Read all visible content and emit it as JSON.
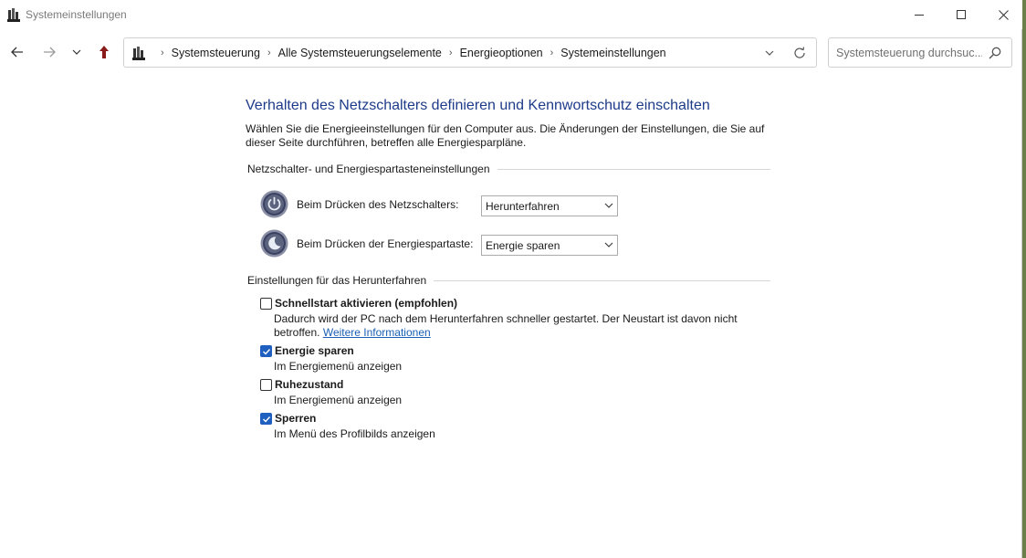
{
  "window": {
    "title": "Systemeinstellungen"
  },
  "nav": {
    "breadcrumbs": [
      {
        "label": "Systemsteuerung"
      },
      {
        "label": "Alle Systemsteuerungselemente"
      },
      {
        "label": "Energieoptionen"
      },
      {
        "label": "Systemeinstellungen"
      }
    ],
    "search_placeholder": "Systemsteuerung durchsuc..."
  },
  "page": {
    "title": "Verhalten des Netzschalters definieren und Kennwortschutz einschalten",
    "intro_line1": "Wählen Sie die Energieeinstellungen für den Computer aus. Die Änderungen der Einstellungen, die Sie auf",
    "intro_line2": "dieser Seite durchführen, betreffen alle Energiesparpläne."
  },
  "power_buttons": {
    "header": "Netzschalter- und Energiespartasteneinstellungen",
    "rows": [
      {
        "label": "Beim Drücken des Netzschalters:",
        "value": "Herunterfahren",
        "icon": "power-button-icon"
      },
      {
        "label": "Beim Drücken der Energiespartaste:",
        "value": "Energie sparen",
        "icon": "sleep-button-icon"
      }
    ]
  },
  "shutdown": {
    "header": "Einstellungen für das Herunterfahren",
    "options": [
      {
        "label": "Schnellstart aktivieren (empfohlen)",
        "checked": false,
        "desc_line1": "Dadurch wird der PC nach dem Herunterfahren schneller gestartet. Der Neustart ist davon nicht",
        "desc_line2": "betroffen.",
        "link": "Weitere Informationen"
      },
      {
        "label": "Energie sparen",
        "checked": true,
        "desc": "Im Energiemenü anzeigen"
      },
      {
        "label": "Ruhezustand",
        "checked": false,
        "desc": "Im Energiemenü anzeigen"
      },
      {
        "label": "Sperren",
        "checked": true,
        "desc": "Im Menü des Profilbilds anzeigen"
      }
    ]
  },
  "colors": {
    "title_blue": "#1e3b8a",
    "link_blue": "#1a5fb4",
    "checkbox_blue": "#1f5fbf"
  }
}
